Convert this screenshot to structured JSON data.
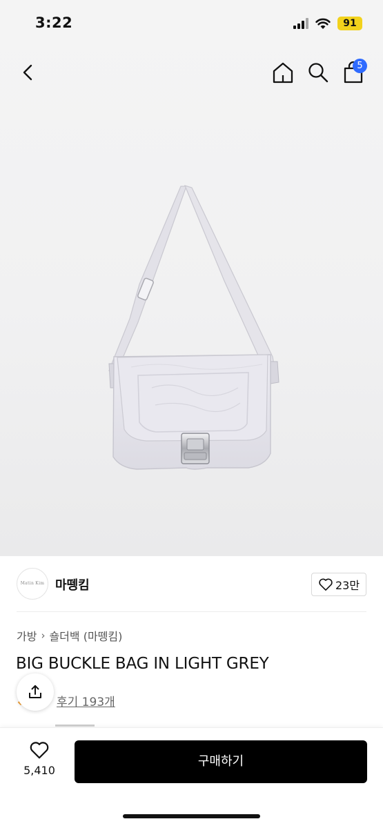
{
  "status_bar": {
    "time": "3:22",
    "battery": "91",
    "battery_color": "#f2d21c"
  },
  "nav": {
    "icons": [
      "chevron-left-icon",
      "home-icon",
      "search-icon",
      "shopping-bag-icon"
    ],
    "cart_count": "5",
    "badge_color": "#2f6bff"
  },
  "seller": {
    "logo_text": "Matin Kim",
    "name": "마뗑킴",
    "likes": "23만"
  },
  "breadcrumb": [
    "가방",
    "숄더백 (마뗑킴)"
  ],
  "product": {
    "name": "BIG BUCKLE BAG IN LIGHT GREY",
    "reviews": "후기 193개"
  },
  "bottom_bar": {
    "wish_count": "5,410",
    "buy_label": "구매하기",
    "buy_color": "#000000"
  }
}
